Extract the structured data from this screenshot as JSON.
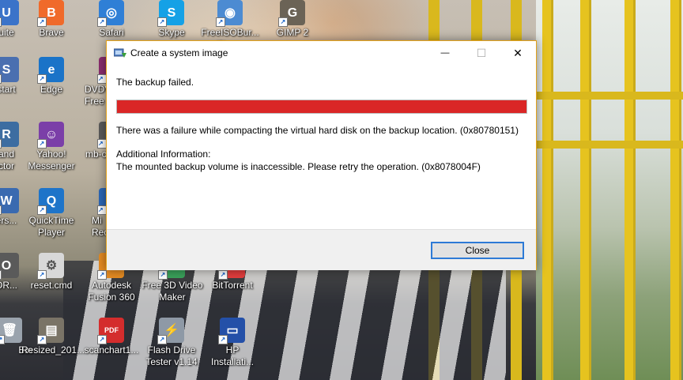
{
  "desktop": {
    "icons": [
      {
        "label": "uite",
        "color": "#3b73c9",
        "glyph": "U"
      },
      {
        "label": "Brave",
        "color": "#f06a2a",
        "glyph": "B"
      },
      {
        "label": "Safari",
        "color": "#2f7fd6",
        "glyph": "◎"
      },
      {
        "label": "Skype",
        "color": "#15a1e6",
        "glyph": "S"
      },
      {
        "label": "FreeISOBur...\n(2).exe",
        "color": "#4c8bd2",
        "glyph": "◉"
      },
      {
        "label": "GIMP 2",
        "color": "#6b6356",
        "glyph": "G"
      },
      {
        "label": "start",
        "color": "#4a6fb0",
        "glyph": "S"
      },
      {
        "label": "Edge",
        "color": "#1a73c8",
        "glyph": "e"
      },
      {
        "label": "DVDV\nFree",
        "color": "#8a2d6e",
        "glyph": "D"
      },
      {
        "label": "and\nctor",
        "color": "#3d6da1",
        "glyph": "R"
      },
      {
        "label": "Yahoo!\nMessenger",
        "color": "#7b3fa8",
        "glyph": "☺"
      },
      {
        "label": "mb-c",
        "color": "#5a5a5a",
        "glyph": "M"
      },
      {
        "label": "ers...",
        "color": "#3a6ab0",
        "glyph": "W"
      },
      {
        "label": "QuickTime\nPlayer",
        "color": "#1e74c9",
        "glyph": "Q"
      },
      {
        "label": "Mi\nRec",
        "color": "#2c67b5",
        "glyph": "M"
      },
      {
        "label": "OR...",
        "color": "#5a5a5a",
        "glyph": "O"
      },
      {
        "label": "reset.cmd",
        "color": "#d8d8d8",
        "glyph": "⚙"
      },
      {
        "label": "Autodesk\nFusion 360",
        "color": "#e58b22",
        "glyph": "F"
      },
      {
        "label": "Free 3D Video\nMaker",
        "color": "#3aa15a",
        "glyph": "3D"
      },
      {
        "label": "BitTorrent",
        "color": "#e23d3d",
        "glyph": "B"
      },
      {
        "label": "Bin",
        "color": "#9aa3ad",
        "glyph": "🗑"
      },
      {
        "label": "Resized_201...",
        "color": "#7a7467",
        "glyph": "▤"
      },
      {
        "label": "scanchart1...",
        "color": "#d42d2d",
        "glyph": "PDF"
      },
      {
        "label": "Flash Drive\nTester v1.14",
        "color": "#8e99a6",
        "glyph": "⚡"
      },
      {
        "label": "HP\nInstallati...",
        "color": "#2450a8",
        "glyph": "▭"
      }
    ]
  },
  "dialog": {
    "title": "Create a system image",
    "minimize": "—",
    "maximize": "☐",
    "close": "✕",
    "heading": "The backup failed.",
    "progress": 1.0,
    "progress_color": "#da2626",
    "error_text": "There was a failure while compacting the virtual hard disk on the backup location. (0x80780151)",
    "additional_label": "Additional Information:",
    "additional_text": "The mounted backup volume is inaccessible. Please retry the operation. (0x8078004F)",
    "close_button": "Close"
  }
}
